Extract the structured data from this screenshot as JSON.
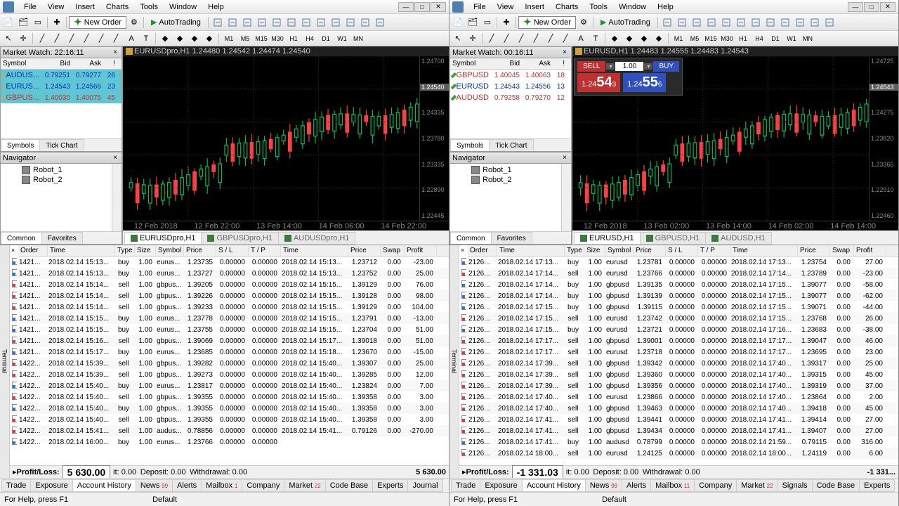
{
  "left": {
    "menus": [
      "File",
      "View",
      "Insert",
      "Charts",
      "Tools",
      "Window",
      "Help"
    ],
    "toolbar": {
      "new_order": "New Order",
      "autotrading": "AutoTrading"
    },
    "timeframes": [
      "M1",
      "M5",
      "M15",
      "M30",
      "H1",
      "H4",
      "D1",
      "W1",
      "MN"
    ],
    "market_watch": {
      "title": "Market Watch: 22:16:11",
      "cols": [
        "Symbol",
        "Bid",
        "Ask",
        "!"
      ],
      "rows": [
        {
          "sym": "AUDUS...",
          "bid": "0.79251",
          "ask": "0.79277",
          "l": "26",
          "hl": true,
          "d": "gold",
          "cls": "blue-t"
        },
        {
          "sym": "EURUS...",
          "bid": "1.24543",
          "ask": "1.24566",
          "l": "23",
          "hl": true,
          "d": "gold",
          "cls": "blue-t"
        },
        {
          "sym": "GBPUS...",
          "bid": "1.40030",
          "ask": "1.40075",
          "l": "45",
          "hl": true,
          "d": "gold",
          "cls": "red-t"
        }
      ],
      "tabs": [
        "Symbols",
        "Tick Chart"
      ]
    },
    "navigator": {
      "title": "Navigator",
      "items": [
        "Robot_1",
        "Robot_2"
      ],
      "tabs": [
        "Common",
        "Favorites"
      ]
    },
    "chart": {
      "title": "EURUSDpro,H1  1.24480 1.24542 1.24474 1.24540",
      "ylabels": [
        "1.24700",
        "1.24540",
        "1.24335",
        "1.23780",
        "1.23335",
        "1.22890",
        "1.22445"
      ],
      "xlabels": [
        "12 Feb 2018",
        "12 Feb 22:00",
        "13 Feb 14:00",
        "14 Feb 06:00",
        "14 Feb 22:00"
      ],
      "tabs": [
        "EURUSDpro,H1",
        "GBPUSDpro,H1",
        "AUDUSDpro,H1"
      ]
    },
    "terminal": {
      "cols": [
        "Order",
        "Time",
        "Type",
        "Size",
        "Symbol",
        "Price",
        "S / L",
        "T / P",
        "Time",
        "Price",
        "Swap",
        "Profit"
      ],
      "rows": [
        [
          "1421...",
          "2018.02.14 15:13...",
          "buy",
          "1.00",
          "eurus...",
          "1.23735",
          "0.00000",
          "0.00000",
          "2018.02.14 15:13...",
          "1.23712",
          "0.00",
          "-23.00",
          "blue"
        ],
        [
          "1421...",
          "2018.02.14 15:13...",
          "buy",
          "1.00",
          "eurus...",
          "1.23727",
          "0.00000",
          "0.00000",
          "2018.02.14 15:13...",
          "1.23752",
          "0.00",
          "25.00",
          "blue"
        ],
        [
          "1421...",
          "2018.02.14 15:14...",
          "sell",
          "1.00",
          "gbpus...",
          "1.39205",
          "0.00000",
          "0.00000",
          "2018.02.14 15:15...",
          "1.39129",
          "0.00",
          "76.00",
          "red"
        ],
        [
          "1421...",
          "2018.02.14 15:14...",
          "sell",
          "1.00",
          "gbpus...",
          "1.39226",
          "0.00000",
          "0.00000",
          "2018.02.14 15:15...",
          "1.39128",
          "0.00",
          "98.00",
          "red"
        ],
        [
          "1421...",
          "2018.02.14 15:14...",
          "sell",
          "1.00",
          "gbpus...",
          "1.39233",
          "0.00000",
          "0.00000",
          "2018.02.14 15:15...",
          "1.39129",
          "0.00",
          "104.00",
          "red"
        ],
        [
          "1421...",
          "2018.02.14 15:15...",
          "buy",
          "1.00",
          "eurus...",
          "1.23778",
          "0.00000",
          "0.00000",
          "2018.02.14 15:15...",
          "1.23791",
          "0.00",
          "-13.00",
          "blue"
        ],
        [
          "1421...",
          "2018.02.14 15:15...",
          "buy",
          "1.00",
          "eurus...",
          "1.23755",
          "0.00000",
          "0.00000",
          "2018.02.14 15:15...",
          "1.23704",
          "0.00",
          "51.00",
          "blue"
        ],
        [
          "1421...",
          "2018.02.14 15:16...",
          "sell",
          "1.00",
          "gbpus...",
          "1.39069",
          "0.00000",
          "0.00000",
          "2018.02.14 15:17...",
          "1.39018",
          "0.00",
          "51.00",
          "red"
        ],
        [
          "1421...",
          "2018.02.14 15:17...",
          "buy",
          "1.00",
          "eurus...",
          "1.23685",
          "0.00000",
          "0.00000",
          "2018.02.14 15:18...",
          "1.23670",
          "0.00",
          "-15.00",
          "blue"
        ],
        [
          "1422...",
          "2018.02.14 15:39...",
          "sell",
          "1.00",
          "gbpus...",
          "1.39282",
          "0.00000",
          "0.00000",
          "2018.02.14 15:40...",
          "1.39307",
          "0.00",
          "25.00",
          "red"
        ],
        [
          "1422...",
          "2018.02.14 15:39...",
          "sell",
          "1.00",
          "gbpus...",
          "1.39273",
          "0.00000",
          "0.00000",
          "2018.02.14 15:40...",
          "1.39285",
          "0.00",
          "12.00",
          "red"
        ],
        [
          "1422...",
          "2018.02.14 15:40...",
          "buy",
          "1.00",
          "eurus...",
          "1.23817",
          "0.00000",
          "0.00000",
          "2018.02.14 15:40...",
          "1.23824",
          "0.00",
          "7.00",
          "blue"
        ],
        [
          "1422...",
          "2018.02.14 15:40...",
          "sell",
          "1.00",
          "gbpus...",
          "1.39355",
          "0.00000",
          "0.00000",
          "2018.02.14 15:40...",
          "1.39358",
          "0.00",
          "3.00",
          "red"
        ],
        [
          "1422...",
          "2018.02.14 15:40...",
          "buy",
          "1.00",
          "gbpus...",
          "1.39355",
          "0.00000",
          "0.00000",
          "2018.02.14 15:40...",
          "1.39358",
          "0.00",
          "3.00",
          "blue"
        ],
        [
          "1422...",
          "2018.02.14 15:40...",
          "sell",
          "1.00",
          "gbpus...",
          "1.39355",
          "0.00000",
          "0.00000",
          "2018.02.14 15:40...",
          "1.39358",
          "0.00",
          "3.00",
          "red"
        ],
        [
          "1422...",
          "2018.02.14 15:41...",
          "sell",
          "1.00",
          "audus...",
          "0.78856",
          "0.00000",
          "0.00000",
          "2018.02.14 15:41...",
          "0.79126",
          "0.00",
          "-270.00",
          "red"
        ],
        [
          "1422...",
          "2018.02.14 16:00...",
          "buy",
          "1.00",
          "eurus...",
          "1.23766",
          "0.00000",
          "0.00000",
          "",
          "",
          "",
          "",
          "blue"
        ]
      ],
      "summary": {
        "pl_label": "Profit/Loss:",
        "pl": "5 630.00",
        "credit": "it: 0.00",
        "deposit": "Deposit: 0.00",
        "withdrawal": "Withdrawal: 0.00",
        "end": "5 630.00"
      },
      "tabs": [
        [
          "Trade",
          ""
        ],
        [
          "Exposure",
          ""
        ],
        [
          "Account History",
          "active"
        ],
        [
          "News",
          "99"
        ],
        [
          "Alerts",
          ""
        ],
        [
          "Mailbox",
          "1"
        ],
        [
          "Company",
          ""
        ],
        [
          "Market",
          "22"
        ],
        [
          "Code Base",
          ""
        ],
        [
          "Experts",
          ""
        ],
        [
          "Journal",
          ""
        ]
      ]
    },
    "status": {
      "help": "For Help, press F1",
      "profile": "Default"
    }
  },
  "right": {
    "menus": [
      "File",
      "View",
      "Insert",
      "Charts",
      "Tools",
      "Window",
      "Help"
    ],
    "toolbar": {
      "new_order": "New Order",
      "autotrading": "AutoTrading"
    },
    "timeframes": [
      "M1",
      "M5",
      "M15",
      "M30",
      "H1",
      "H4",
      "D1",
      "W1",
      "MN"
    ],
    "market_watch": {
      "title": "Market Watch: 00:16:11",
      "cols": [
        "Symbol",
        "Bid",
        "Ask",
        "!"
      ],
      "rows": [
        {
          "sym": "GBPUSD",
          "bid": "1.40045",
          "ask": "1.40063",
          "l": "18",
          "d": "green",
          "cls": "red-t"
        },
        {
          "sym": "EURUSD",
          "bid": "1.24543",
          "ask": "1.24556",
          "l": "13",
          "d": "green",
          "cls": "blue-t"
        },
        {
          "sym": "AUDUSD",
          "bid": "0.79258",
          "ask": "0.79270",
          "l": "12",
          "d": "green",
          "cls": "red-t"
        }
      ],
      "tabs": [
        "Symbols",
        "Tick Chart"
      ]
    },
    "navigator": {
      "title": "Navigator",
      "items": [
        "Robot_1",
        "Robot_2"
      ],
      "tabs": [
        "Common",
        "Favorites"
      ]
    },
    "chart": {
      "title": "EURUSD,H1  1.24483 1.24555 1.24483 1.24543",
      "oc": {
        "sell": "SELL",
        "buy": "BUY",
        "vol": "1.00",
        "p1_pre": "1.24",
        "p1_big": "54",
        "p1_sup": "3",
        "p2_pre": "1.24",
        "p2_big": "55",
        "p2_sup": "6"
      },
      "ylabels": [
        "1.24725",
        "1.24543",
        "1.24275",
        "1.23820",
        "1.23365",
        "1.22910",
        "1.22460"
      ],
      "xlabels": [
        "12 Feb 2018",
        "13 Feb 02:00",
        "13 Feb 14:00",
        "14 Feb 02:00",
        "14 Feb 14:00"
      ],
      "tabs": [
        "EURUSD,H1",
        "GBPUSD,H1",
        "AUDUSD,H1"
      ]
    },
    "terminal": {
      "cols": [
        "Order",
        "Time",
        "Type",
        "Size",
        "Symbol",
        "Price",
        "S / L",
        "T / P",
        "Time",
        "Price",
        "Swap",
        "Profit"
      ],
      "rows": [
        [
          "2126...",
          "2018.02.14 17:13...",
          "buy",
          "1.00",
          "eurusd",
          "1.23781",
          "0.00000",
          "0.00000",
          "2018.02.14 17:13...",
          "1.23754",
          "0.00",
          "27.00",
          "blue"
        ],
        [
          "2126...",
          "2018.02.14 17:14...",
          "sell",
          "1.00",
          "eurusd",
          "1.23766",
          "0.00000",
          "0.00000",
          "2018.02.14 17:14...",
          "1.23789",
          "0.00",
          "-23.00",
          "red"
        ],
        [
          "2126...",
          "2018.02.14 17:14...",
          "buy",
          "1.00",
          "gbpusd",
          "1.39135",
          "0.00000",
          "0.00000",
          "2018.02.14 17:15...",
          "1.39077",
          "0.00",
          "-58.00",
          "blue"
        ],
        [
          "2126...",
          "2018.02.14 17:14...",
          "buy",
          "1.00",
          "gbpusd",
          "1.39139",
          "0.00000",
          "0.00000",
          "2018.02.14 17:15...",
          "1.39077",
          "0.00",
          "-62.00",
          "blue"
        ],
        [
          "2126...",
          "2018.02.14 17:15...",
          "buy",
          "1.00",
          "gbpusd",
          "1.39115",
          "0.00000",
          "0.00000",
          "2018.02.14 17:15...",
          "1.39071",
          "0.00",
          "-44.00",
          "blue"
        ],
        [
          "2126...",
          "2018.02.14 17:15...",
          "sell",
          "1.00",
          "eurusd",
          "1.23742",
          "0.00000",
          "0.00000",
          "2018.02.14 17:15...",
          "1.23768",
          "0.00",
          "26.00",
          "red"
        ],
        [
          "2126...",
          "2018.02.14 17:15...",
          "buy",
          "1.00",
          "eurusd",
          "1.23721",
          "0.00000",
          "0.00000",
          "2018.02.14 17:16...",
          "1.23683",
          "0.00",
          "-38.00",
          "blue"
        ],
        [
          "2126...",
          "2018.02.14 17:17...",
          "sell",
          "1.00",
          "gbpusd",
          "1.39001",
          "0.00000",
          "0.00000",
          "2018.02.14 17:17...",
          "1.39047",
          "0.00",
          "46.00",
          "red"
        ],
        [
          "2126...",
          "2018.02.14 17:17...",
          "sell",
          "1.00",
          "eurusd",
          "1.23718",
          "0.00000",
          "0.00000",
          "2018.02.14 17:17...",
          "1.23695",
          "0.00",
          "23.00",
          "red"
        ],
        [
          "2126...",
          "2018.02.14 17:39...",
          "sell",
          "1.00",
          "gbpusd",
          "1.39342",
          "0.00000",
          "0.00000",
          "2018.02.14 17:40...",
          "1.39317",
          "0.00",
          "25.00",
          "red"
        ],
        [
          "2126...",
          "2018.02.14 17:39...",
          "sell",
          "1.00",
          "gbpusd",
          "1.39360",
          "0.00000",
          "0.00000",
          "2018.02.14 17:40...",
          "1.39315",
          "0.00",
          "45.00",
          "red"
        ],
        [
          "2126...",
          "2018.02.14 17:39...",
          "sell",
          "1.00",
          "gbpusd",
          "1.39356",
          "0.00000",
          "0.00000",
          "2018.02.14 17:40...",
          "1.39319",
          "0.00",
          "37.00",
          "red"
        ],
        [
          "2126...",
          "2018.02.14 17:40...",
          "sell",
          "1.00",
          "eurusd",
          "1.23866",
          "0.00000",
          "0.00000",
          "2018.02.14 17:40...",
          "1.23864",
          "0.00",
          "2.00",
          "red"
        ],
        [
          "2126...",
          "2018.02.14 17:40...",
          "sell",
          "1.00",
          "gbpusd",
          "1.39463",
          "0.00000",
          "0.00000",
          "2018.02.14 17:40...",
          "1.39418",
          "0.00",
          "45.00",
          "red"
        ],
        [
          "2126...",
          "2018.02.14 17:41...",
          "sell",
          "1.00",
          "gbpusd",
          "1.39441",
          "0.00000",
          "0.00000",
          "2018.02.14 17:41...",
          "1.39414",
          "0.00",
          "27.00",
          "red"
        ],
        [
          "2126...",
          "2018.02.14 17:41...",
          "sell",
          "1.00",
          "gbpusd",
          "1.39434",
          "0.00000",
          "0.00000",
          "2018.02.14 17:41...",
          "1.39407",
          "0.00",
          "27.00",
          "red"
        ],
        [
          "2126...",
          "2018.02.14 17:41...",
          "buy",
          "1.00",
          "audusd",
          "0.78799",
          "0.00000",
          "0.00000",
          "2018.02.14 21:59...",
          "0.79115",
          "0.00",
          "316.00",
          "blue"
        ],
        [
          "2126...",
          "2018.02.14 18:00...",
          "sell",
          "1.00",
          "eurusd",
          "1.24125",
          "0.00000",
          "0.00000",
          "2018.02.14 18:00...",
          "1.24119",
          "0.00",
          "6.00",
          "red"
        ]
      ],
      "summary": {
        "pl_label": "Profit/Loss:",
        "pl": "-1 331.03",
        "credit": "it: 0.00",
        "deposit": "Deposit: 0.00",
        "withdrawal": "Withdrawal: 0.00",
        "end": "-1 331..."
      },
      "tabs": [
        [
          "Trade",
          ""
        ],
        [
          "Exposure",
          ""
        ],
        [
          "Account History",
          "active"
        ],
        [
          "News",
          "99"
        ],
        [
          "Alerts",
          ""
        ],
        [
          "Mailbox",
          "11"
        ],
        [
          "Company",
          ""
        ],
        [
          "Market",
          "22"
        ],
        [
          "Signals",
          ""
        ],
        [
          "Code Base",
          ""
        ],
        [
          "Experts",
          ""
        ]
      ]
    },
    "status": {
      "help": "For Help, press F1",
      "profile": "Default"
    }
  }
}
